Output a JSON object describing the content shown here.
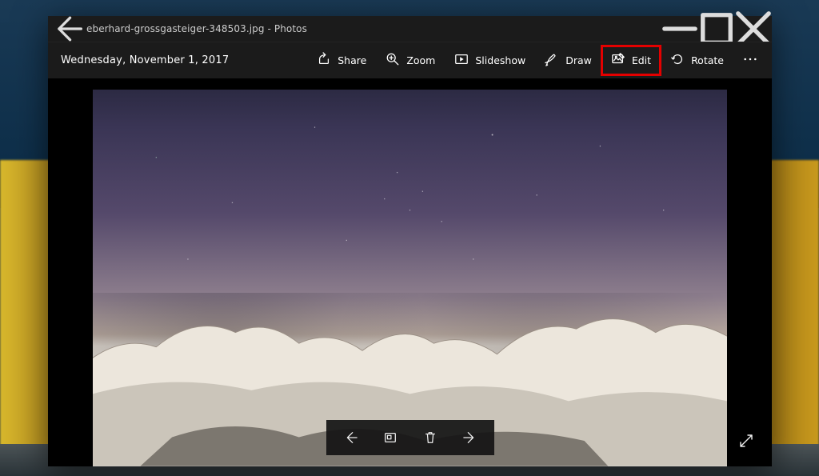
{
  "window": {
    "title": "eberhard-grossgasteiger-348503.jpg - Photos"
  },
  "date": "Wednesday, November 1, 2017",
  "toolbar": {
    "share": "Share",
    "zoom": "Zoom",
    "slideshow": "Slideshow",
    "draw": "Draw",
    "edit": "Edit",
    "rotate": "Rotate"
  },
  "highlight_tool": "edit"
}
